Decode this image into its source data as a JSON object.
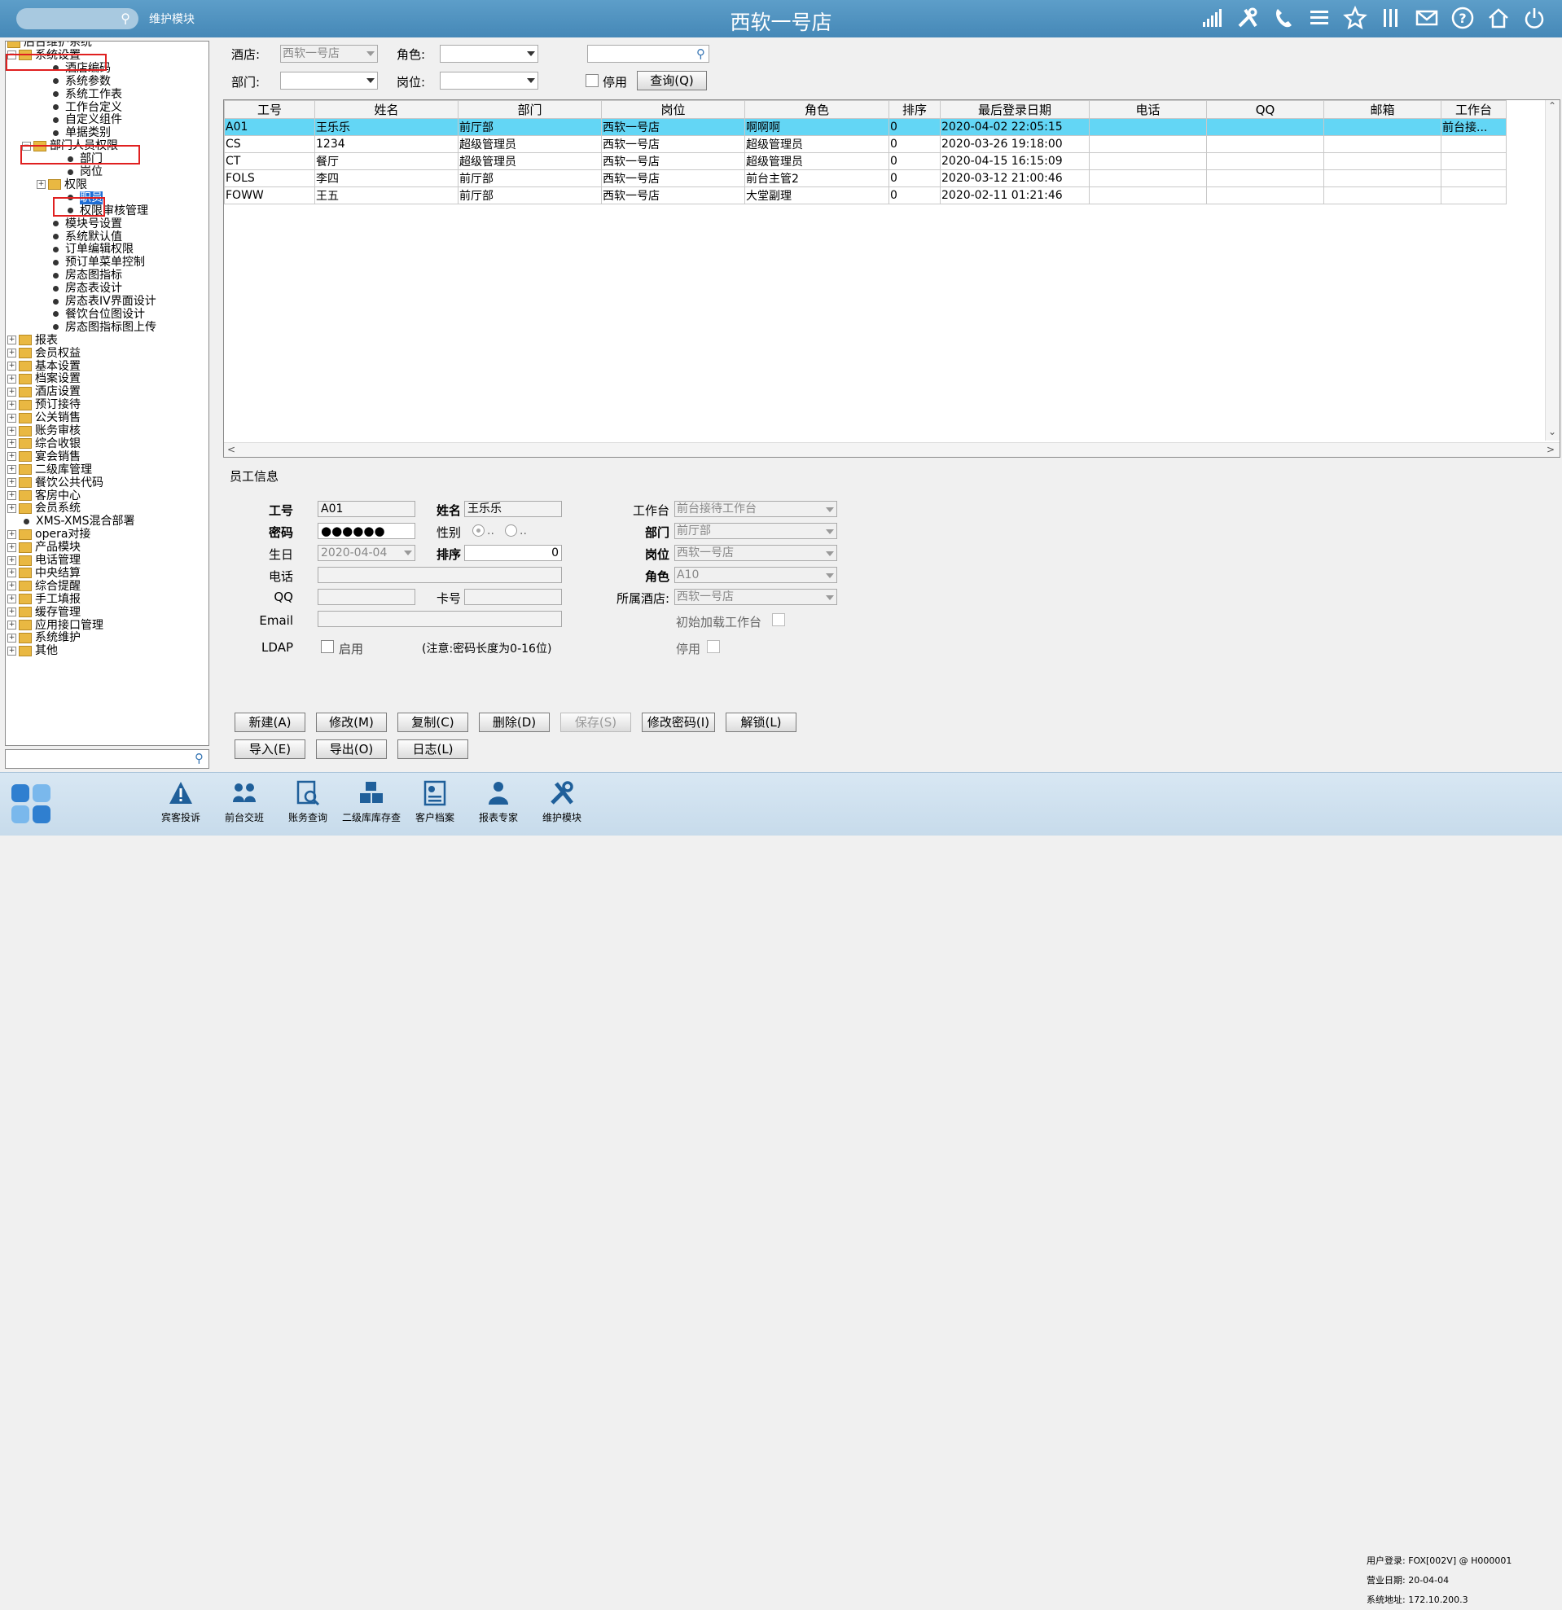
{
  "header": {
    "title": "西软一号店",
    "module_label": "维护模块",
    "search_icon": "search-icon",
    "icons": [
      "signal-icon",
      "tools-icon",
      "phone-icon",
      "menu-icon",
      "star-icon",
      "columns-icon",
      "mail-icon",
      "help-icon",
      "home-icon",
      "power-icon"
    ]
  },
  "tree": {
    "nodes": [
      {
        "label": "后台维护系统",
        "type": "root"
      },
      {
        "label": "系统设置",
        "type": "folder-open"
      },
      {
        "label": "酒店编码",
        "type": "leaf"
      },
      {
        "label": "系统参数",
        "type": "leaf"
      },
      {
        "label": "系统工作表",
        "type": "leaf"
      },
      {
        "label": "工作台定义",
        "type": "leaf"
      },
      {
        "label": "自定义组件",
        "type": "leaf"
      },
      {
        "label": "单据类别",
        "type": "leaf"
      },
      {
        "label": "部门人员权限",
        "type": "folder-open"
      },
      {
        "label": "部门",
        "type": "leaf"
      },
      {
        "label": "岗位",
        "type": "leaf"
      },
      {
        "label": "权限",
        "type": "folder"
      },
      {
        "label": "职员",
        "type": "leaf"
      },
      {
        "label": "权限审核管理",
        "type": "leaf"
      },
      {
        "label": "模块号设置",
        "type": "leaf"
      },
      {
        "label": "系统默认值",
        "type": "leaf"
      },
      {
        "label": "订单编辑权限",
        "type": "leaf"
      },
      {
        "label": "预订单菜单控制",
        "type": "leaf"
      },
      {
        "label": "房态图指标",
        "type": "leaf"
      },
      {
        "label": "房态表设计",
        "type": "leaf"
      },
      {
        "label": "房态表IV界面设计",
        "type": "leaf"
      },
      {
        "label": "餐饮台位图设计",
        "type": "leaf"
      },
      {
        "label": "房态图指标图上传",
        "type": "leaf"
      },
      {
        "label": "报表",
        "type": "folder"
      },
      {
        "label": "会员权益",
        "type": "folder"
      },
      {
        "label": "基本设置",
        "type": "folder"
      },
      {
        "label": "档案设置",
        "type": "folder"
      },
      {
        "label": "酒店设置",
        "type": "folder"
      },
      {
        "label": "预订接待",
        "type": "folder"
      },
      {
        "label": "公关销售",
        "type": "folder"
      },
      {
        "label": "账务审核",
        "type": "folder"
      },
      {
        "label": "综合收银",
        "type": "folder"
      },
      {
        "label": "宴会销售",
        "type": "folder"
      },
      {
        "label": "二级库管理",
        "type": "folder"
      },
      {
        "label": "餐饮公共代码",
        "type": "folder"
      },
      {
        "label": "客房中心",
        "type": "folder"
      },
      {
        "label": "会员系统",
        "type": "folder"
      },
      {
        "label": "XMS-XMS混合部署",
        "type": "leaf"
      },
      {
        "label": "opera对接",
        "type": "folder"
      },
      {
        "label": "产品模块",
        "type": "folder"
      },
      {
        "label": "电话管理",
        "type": "folder"
      },
      {
        "label": "中央结算",
        "type": "folder"
      },
      {
        "label": "综合提醒",
        "type": "folder"
      },
      {
        "label": "手工填报",
        "type": "folder"
      },
      {
        "label": "缓存管理",
        "type": "folder"
      },
      {
        "label": "应用接口管理",
        "type": "folder"
      },
      {
        "label": "系统维护",
        "type": "folder"
      },
      {
        "label": "其他",
        "type": "folder"
      }
    ]
  },
  "filter": {
    "hotel_label": "酒店:",
    "hotel_value": "西软一号店",
    "role_label": "角色:",
    "role_value": "",
    "dept_label": "部门:",
    "dept_value": "",
    "post_label": "岗位:",
    "post_value": "",
    "search_value": "",
    "disable_label": "停用",
    "query_button": "查询(Q)"
  },
  "grid": {
    "columns": [
      "工号",
      "姓名",
      "部门",
      "岗位",
      "角色",
      "排序",
      "最后登录日期",
      "电话",
      "QQ",
      "邮箱",
      "工作台"
    ],
    "rows": [
      [
        "A01",
        "王乐乐",
        "前厅部",
        "西软一号店",
        "啊啊啊",
        "0",
        "2020-04-02 22:05:15",
        "",
        "",
        "",
        "前台接..."
      ],
      [
        "CS",
        "1234",
        "超级管理员",
        "西软一号店",
        "超级管理员",
        "0",
        "2020-03-26 19:18:00",
        "",
        "",
        "",
        ""
      ],
      [
        "CT",
        "餐厅",
        "超级管理员",
        "西软一号店",
        "超级管理员",
        "0",
        "2020-04-15 16:15:09",
        "",
        "",
        "",
        ""
      ],
      [
        "FOLS",
        "李四",
        "前厅部",
        "西软一号店",
        "前台主管2",
        "0",
        "2020-03-12 21:00:46",
        "",
        "",
        "",
        ""
      ],
      [
        "FOWW",
        "王五",
        "前厅部",
        "西软一号店",
        "大堂副理",
        "0",
        "2020-02-11 01:21:46",
        "",
        "",
        "",
        ""
      ]
    ],
    "selected_row": 0
  },
  "detail": {
    "section_title": "员工信息",
    "id_label": "工号",
    "id_value": "A01",
    "name_label": "姓名",
    "name_value": "王乐乐",
    "pwd_label": "密码",
    "pwd_value": "●●●●●●",
    "gender_label": "性别",
    "gender_opt1": "..",
    "gender_opt2": "..",
    "birth_label": "生日",
    "birth_value": "2020-04-04",
    "sort_label": "排序",
    "sort_value": "0",
    "phone_label": "电话",
    "phone_value": "",
    "qq_label": "QQ",
    "qq_value": "",
    "card_label": "卡号",
    "card_value": "",
    "email_label": "Email",
    "email_value": "",
    "ldap_label": "LDAP",
    "ldap_enable_label": "启用",
    "note": "(注意:密码长度为0-16位)",
    "workbench_label": "工作台",
    "workbench_value": "前台接待工作台",
    "dept_label": "部门",
    "dept_value": "前厅部",
    "post_label": "岗位",
    "post_value": "西软一号店",
    "role_label": "角色",
    "role_value": "A10",
    "hotel_label": "所属酒店:",
    "hotel_value": "西软一号店",
    "init_load_label": "初始加载工作台",
    "disable_label": "停用"
  },
  "buttons": {
    "new": "新建(A)",
    "modify": "修改(M)",
    "copy": "复制(C)",
    "delete": "删除(D)",
    "save": "保存(S)",
    "change_pwd": "修改密码(I)",
    "unlock": "解锁(L)",
    "import": "导入(E)",
    "export": "导出(O)",
    "log": "日志(L)"
  },
  "taskbar": {
    "items": [
      {
        "label": "宾客投诉",
        "icon": "warning-icon"
      },
      {
        "label": "前台交班",
        "icon": "handover-icon"
      },
      {
        "label": "账务查询",
        "icon": "bill-search-icon"
      },
      {
        "label": "二级库库存查",
        "icon": "boxes-icon"
      },
      {
        "label": "客户档案",
        "icon": "profile-icon"
      },
      {
        "label": "报表专家",
        "icon": "report-expert-icon"
      },
      {
        "label": "维护模块",
        "icon": "tools-icon"
      }
    ],
    "status": {
      "user": "用户登录: FOX[002V] @ H000001",
      "bizdate": "营业日期: 20-04-04",
      "addr": "系统地址: 172.10.200.3"
    }
  },
  "colors": {
    "header_bg": "#4e92c0",
    "selected_row": "#63d6f5",
    "highlight_box": "#e02020"
  }
}
